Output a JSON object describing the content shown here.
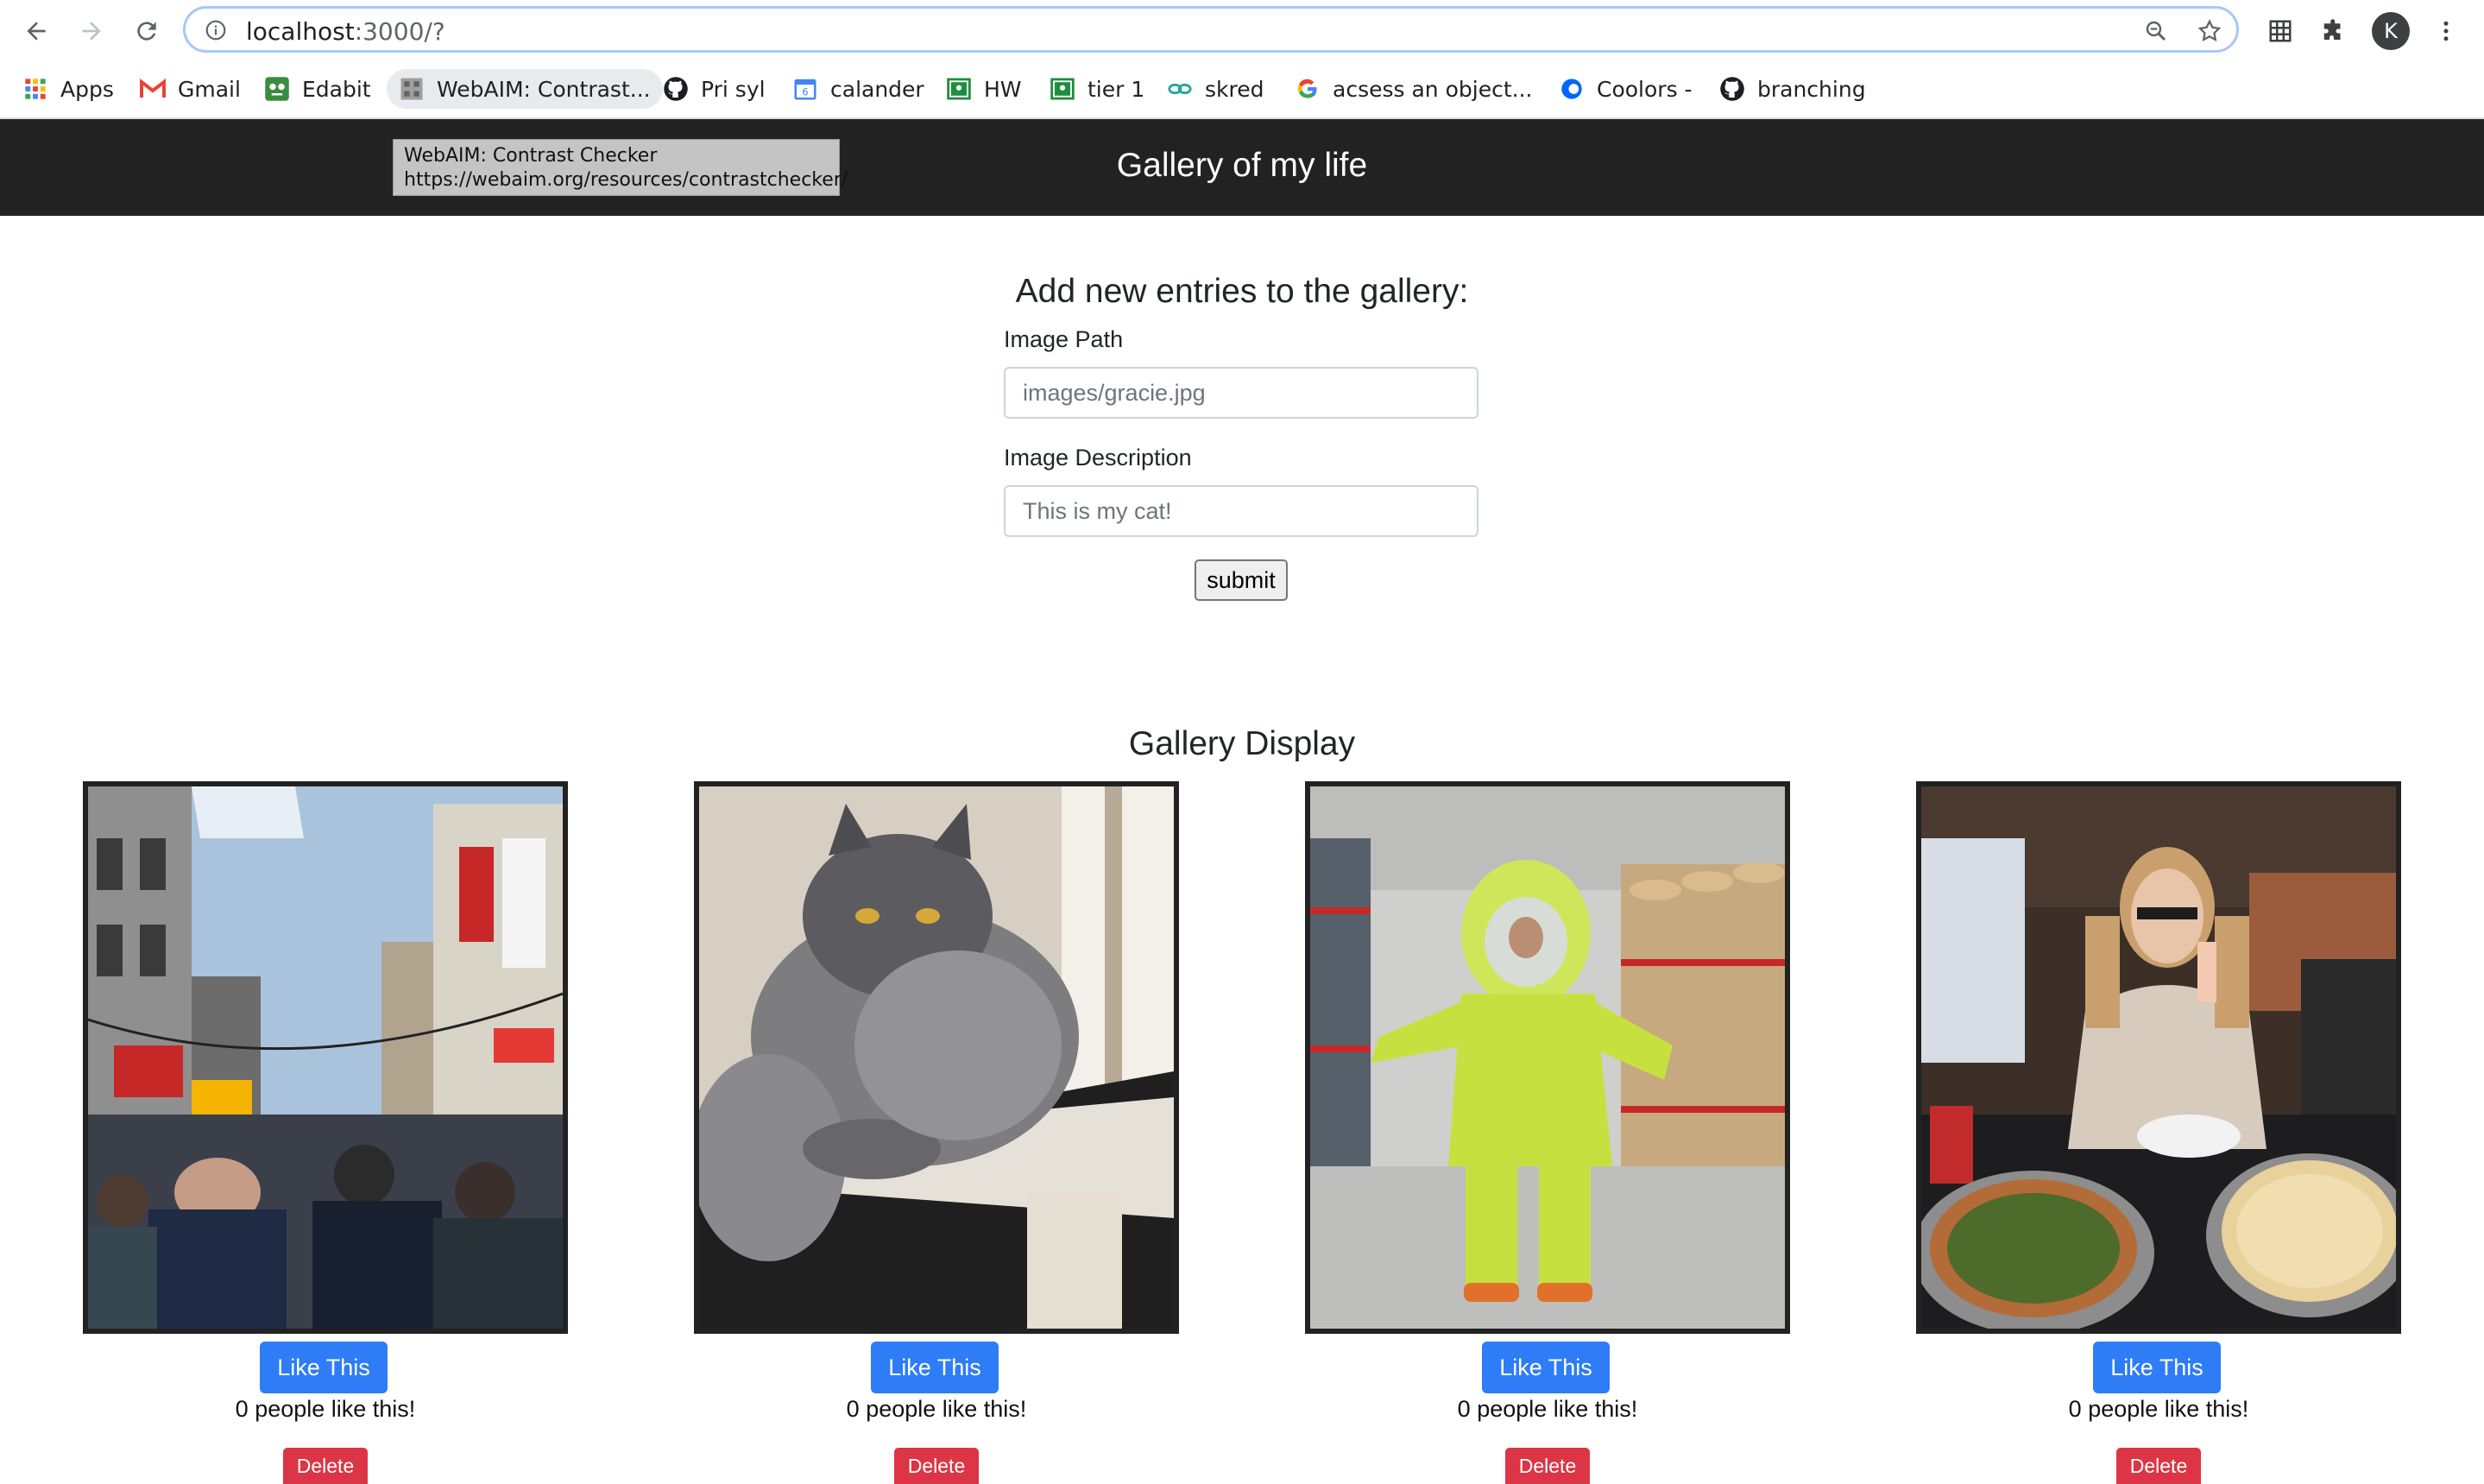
{
  "browser": {
    "url_host": "localhost",
    "url_path": ":3000/?",
    "profile_initial": "K"
  },
  "bookmarks": [
    {
      "label": "Apps",
      "icon": "apps-grid-icon"
    },
    {
      "label": "Gmail",
      "icon": "gmail-icon"
    },
    {
      "label": "Edabit",
      "icon": "edabit-icon"
    },
    {
      "label": "WebAIM: Contrast...",
      "icon": "webaim-icon"
    },
    {
      "label": "Pri syl",
      "icon": "github-icon"
    },
    {
      "label": "calander",
      "icon": "calendar-icon"
    },
    {
      "label": "HW",
      "icon": "classroom-icon"
    },
    {
      "label": "tier 1",
      "icon": "classroom-icon"
    },
    {
      "label": "skred",
      "icon": "link-icon"
    },
    {
      "label": "acsess an object...",
      "icon": "google-icon"
    },
    {
      "label": "Coolors -",
      "icon": "coolors-icon"
    },
    {
      "label": "branching",
      "icon": "github-icon"
    }
  ],
  "tooltip": {
    "title": "WebAIM: Contrast Checker",
    "url": "https://webaim.org/resources/contrastchecker/"
  },
  "header": {
    "title": "Gallery of my life"
  },
  "form": {
    "heading": "Add new entries to the gallery:",
    "path_label": "Image Path",
    "path_placeholder": "images/gracie.jpg",
    "description_label": "Image Description",
    "description_placeholder": "This is my cat!",
    "submit_label": "submit"
  },
  "gallery": {
    "heading": "Gallery Display",
    "items": [
      {
        "photo": "street-market-photo",
        "like_label": "Like This",
        "likes_text": "0 people like this!",
        "delete_label": "Delete"
      },
      {
        "photo": "cat-photo",
        "like_label": "Like This",
        "likes_text": "0 people like this!",
        "delete_label": "Delete"
      },
      {
        "photo": "hazmat-suit-photo",
        "like_label": "Like This",
        "likes_text": "0 people like this!",
        "delete_label": "Delete"
      },
      {
        "photo": "pizza-dinner-photo",
        "like_label": "Like This",
        "likes_text": "0 people like this!",
        "delete_label": "Delete"
      }
    ]
  },
  "colors": {
    "header_bg": "#222222",
    "like_button": "#2e7cf6",
    "delete_button": "#dc3545",
    "photo_border": "#222222"
  }
}
